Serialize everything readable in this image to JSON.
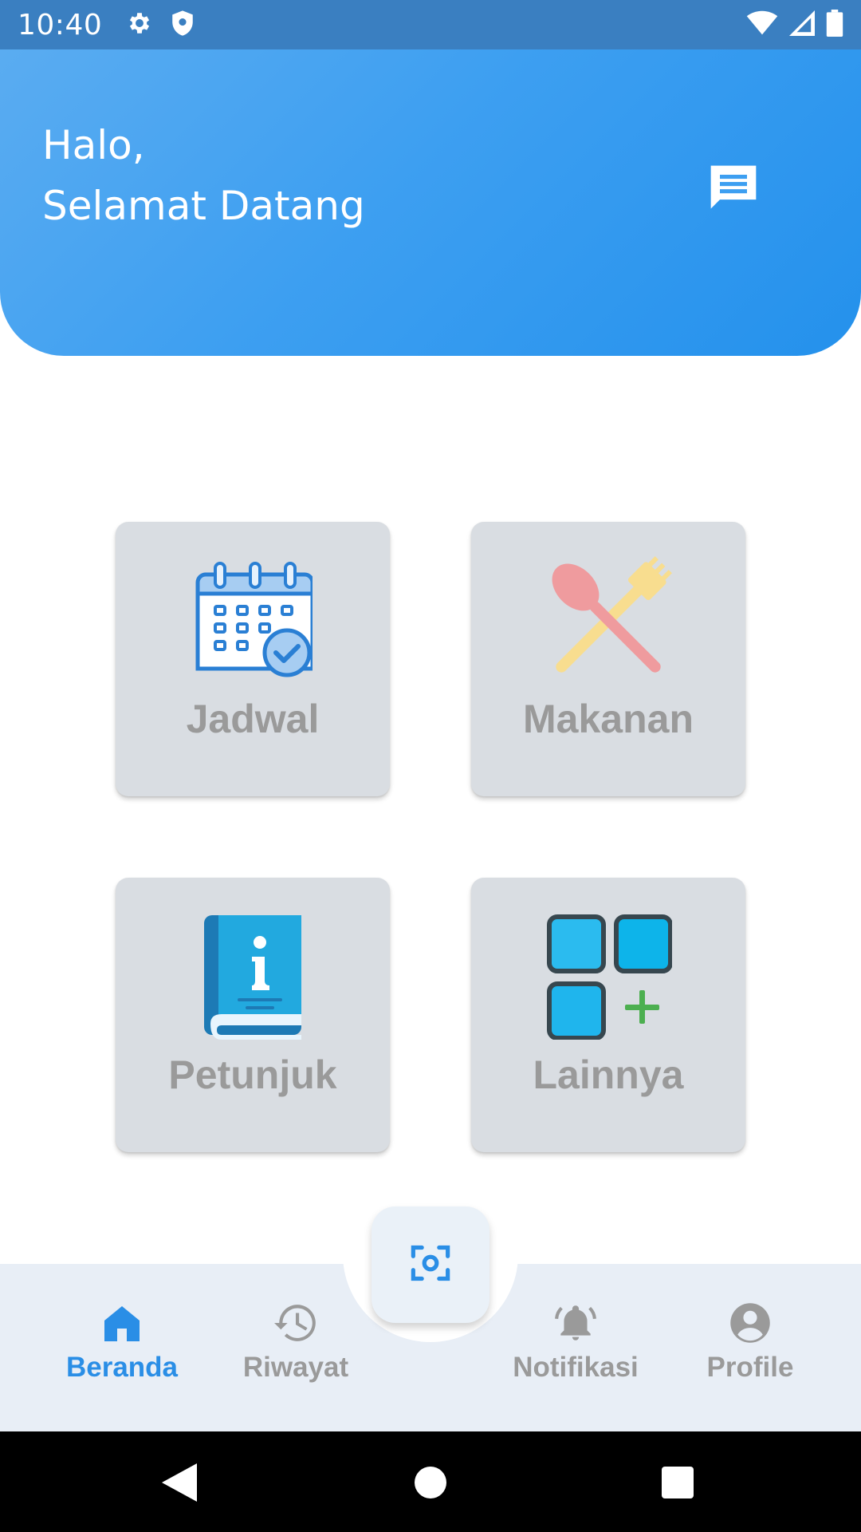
{
  "status_bar": {
    "time": "10:40",
    "icons_left": [
      "gear-icon",
      "shield-icon"
    ],
    "icons_right": [
      "wifi-icon",
      "signal-icon",
      "battery-icon"
    ]
  },
  "header": {
    "greeting_line1": "Halo,",
    "greeting_line2": "Selamat Datang",
    "chat_icon": "chat-icon",
    "gradient_colors": [
      "#5aacf1",
      "#2491ec"
    ]
  },
  "menu": {
    "items": [
      {
        "label": "Jadwal",
        "icon": "calendar-icon"
      },
      {
        "label": "Makanan",
        "icon": "spoon-fork-icon"
      },
      {
        "label": "Petunjuk",
        "icon": "info-book-icon"
      },
      {
        "label": "Lainnya",
        "icon": "apps-add-icon"
      }
    ]
  },
  "bottom_nav": {
    "items": [
      {
        "label": "Beranda",
        "icon": "home-icon",
        "active": true
      },
      {
        "label": "Riwayat",
        "icon": "history-icon",
        "active": false
      },
      {
        "label": "Notifikasi",
        "icon": "bell-icon",
        "active": false
      },
      {
        "label": "Profile",
        "icon": "account-icon",
        "active": false
      }
    ],
    "fab_icon": "scan-icon",
    "active_color": "#2a8ee6",
    "inactive_color": "#9a9a9a"
  },
  "system_nav": {
    "icons": [
      "back-icon",
      "home-circle-icon",
      "recents-icon"
    ]
  }
}
